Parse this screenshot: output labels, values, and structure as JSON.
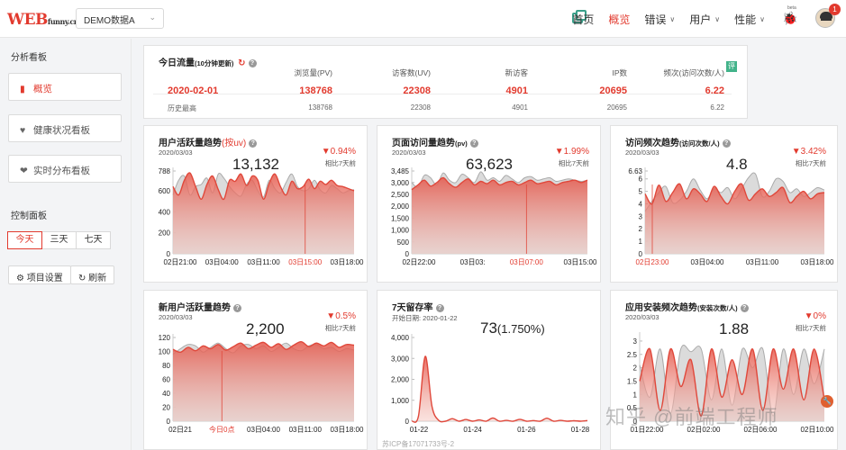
{
  "header": {
    "logo_main": "WEB",
    "logo_sub": "funny.cn",
    "project": "DEMO数据A",
    "nav": [
      {
        "label": "首页",
        "active": false,
        "caret": false
      },
      {
        "label": "概览",
        "active": true,
        "caret": false
      },
      {
        "label": "错误",
        "active": false,
        "caret": true
      },
      {
        "label": "用户",
        "active": false,
        "caret": true
      },
      {
        "label": "性能",
        "active": false,
        "caret": true
      }
    ],
    "beta": "beta",
    "notifications": "1"
  },
  "sidebar": {
    "analysis_title": "分析看板",
    "boards": [
      "概览",
      "健康状况看板",
      "实时分布看板"
    ],
    "control_title": "控制面板",
    "ranges": [
      "今天",
      "三天",
      "七天"
    ],
    "project_settings": "项目设置",
    "refresh": "刷新"
  },
  "traffic": {
    "title": "今日流量",
    "title_note": "(10分钟更新)",
    "badge": "评",
    "columns": [
      {
        "head": "",
        "value": "2020-02-01",
        "sub": "历史最高"
      },
      {
        "head": "浏览量(PV)",
        "value": "138768",
        "sub": "138768"
      },
      {
        "head": "访客数(UV)",
        "value": "22308",
        "sub": "22308"
      },
      {
        "head": "新访客",
        "value": "4901",
        "sub": "4901"
      },
      {
        "head": "IP数",
        "value": "20695",
        "sub": "20695"
      },
      {
        "head": "频次(访问次数/人)",
        "value": "6.22",
        "sub": "6.22"
      }
    ]
  },
  "cards": [
    {
      "title": "用户活跃量趋势",
      "title_hl": "(按uv)",
      "title_small": "",
      "date": "2020/03/03",
      "big": "13,132",
      "change": "▼0.94%",
      "change_sub": "相比7天前",
      "chart_data": {
        "type": "area",
        "yticks": [
          "0",
          "200",
          "400",
          "600",
          "788"
        ],
        "ylim": [
          0,
          788
        ],
        "xticks": [
          "02日21:00",
          "03日04:00",
          "03日11:00",
          "03日15:00",
          "03日18:00"
        ],
        "highlight_tick": "03日15:00",
        "values": [
          640,
          560,
          700,
          770,
          640,
          520,
          660,
          740,
          610,
          520,
          700,
          690,
          760,
          650,
          740,
          700,
          520,
          670,
          760,
          640,
          560,
          690,
          620,
          640,
          710,
          620,
          690,
          660,
          700,
          650,
          640,
          620,
          600
        ],
        "compare": [
          560,
          700,
          740,
          560,
          640,
          660,
          720,
          580,
          760,
          720,
          640,
          580,
          550,
          660,
          700,
          600,
          540,
          700,
          620,
          580,
          680,
          760,
          640,
          600,
          620,
          700,
          610,
          580,
          650,
          620,
          580,
          600,
          610
        ]
      }
    },
    {
      "title": "页面访问量趋势",
      "title_hl": "",
      "title_small": "(pv)",
      "date": "2020/03/03",
      "big": "63,623",
      "change": "▼1.99%",
      "change_sub": "相比7天前",
      "chart_data": {
        "type": "area",
        "yticks": [
          "0",
          "500",
          "1,000",
          "1,500",
          "2,000",
          "2,500",
          "3,000",
          "3,485"
        ],
        "ylim": [
          0,
          3485
        ],
        "xticks": [
          "02日22:00",
          "03日03:",
          "03日07:00",
          "03日15:00"
        ],
        "highlight_tick": "03日07:00",
        "values": [
          2700,
          2900,
          3100,
          2850,
          3000,
          3200,
          2950,
          2800,
          3000,
          3150,
          2900,
          3050,
          2950,
          3100,
          2900,
          3000,
          3050,
          2900,
          3000,
          3100,
          2950,
          3000,
          3050,
          2900,
          3000,
          3050,
          3100,
          3000,
          3100
        ],
        "compare": [
          3000,
          2800,
          3300,
          3200,
          2900,
          3400,
          3100,
          3000,
          3350,
          3200,
          3000,
          3450,
          3100,
          3200,
          3050,
          3300,
          3150,
          3000,
          3200,
          3250,
          3100,
          3150,
          3200,
          3050,
          3100,
          3150,
          3100,
          3050,
          3100
        ]
      }
    },
    {
      "title": "访问频次趋势",
      "title_hl": "",
      "title_small": "(访问次数/人)",
      "date": "2020/03/03",
      "big": "4.8",
      "change": "▼3.42%",
      "change_sub": "相比7天前",
      "chart_data": {
        "type": "area",
        "yticks": [
          "0",
          "1",
          "2",
          "3",
          "4",
          "5",
          "6",
          "6.63"
        ],
        "ylim": [
          0,
          6.63
        ],
        "xticks": [
          "02日23:00",
          "03日04:00",
          "03日11:00",
          "03日18:00"
        ],
        "highlight_tick": "02日23:00",
        "values": [
          4.8,
          4.0,
          5.5,
          4.2,
          4.9,
          5.6,
          4.4,
          5.2,
          4.8,
          4.2,
          5.4,
          4.6,
          4.0,
          5.0,
          5.6,
          4.3,
          4.8,
          5.2,
          4.6,
          4.9,
          5.3,
          4.1,
          4.6,
          5.0,
          4.4,
          4.8,
          4.9
        ],
        "compare": [
          3.4,
          4.2,
          4.9,
          5.4,
          4.1,
          4.3,
          5.0,
          6.0,
          5.1,
          4.4,
          5.2,
          4.9,
          5.3,
          4.4,
          5.2,
          6.1,
          6.4,
          4.6,
          5.0,
          6.0,
          5.8,
          4.9,
          5.2,
          4.6,
          4.9,
          5.3,
          5.1
        ]
      }
    },
    {
      "title": "新用户活跃量趋势",
      "title_hl": "",
      "title_small": "",
      "date": "2020/03/03",
      "big": "2,200",
      "change": "▼0.5%",
      "change_sub": "相比7天前",
      "chart_data": {
        "type": "area",
        "yticks": [
          "0",
          "20",
          "40",
          "60",
          "80",
          "100",
          "120"
        ],
        "ylim": [
          0,
          120
        ],
        "xticks": [
          "02日21",
          "今日0点",
          "03日04:00",
          "03日11:00",
          "03日18:00"
        ],
        "highlight_tick": "今日0点",
        "values": [
          103,
          99,
          106,
          101,
          108,
          104,
          110,
          102,
          107,
          112,
          104,
          109,
          113,
          106,
          111,
          103,
          109,
          114,
          107,
          112,
          108,
          113,
          106,
          110,
          109
        ],
        "compare": [
          96,
          104,
          110,
          108,
          99,
          106,
          112,
          104,
          98,
          108,
          110,
          104,
          108,
          100,
          106,
          112,
          104,
          101,
          108,
          110,
          104,
          106,
          100,
          104,
          102
        ]
      }
    },
    {
      "title": "7天留存率",
      "title_hl": "",
      "title_small": "",
      "date": "开始日期: 2020-01-22",
      "big": "73",
      "big_note": "(1.750%)",
      "change": "",
      "change_sub": "",
      "chart_data": {
        "type": "area",
        "yticks": [
          "0",
          "1,000",
          "2,000",
          "3,000",
          "4,000"
        ],
        "ylim": [
          0,
          4000
        ],
        "xticks": [
          "01-22",
          "01-24",
          "01-26",
          "01-28"
        ],
        "highlight_tick": "",
        "values": [
          0,
          250,
          3100,
          700,
          40,
          0,
          120,
          0,
          80,
          0,
          60,
          0,
          150,
          0,
          40,
          0,
          90,
          0,
          30,
          0,
          140,
          0,
          40,
          0,
          20,
          0,
          30
        ],
        "compare": []
      }
    },
    {
      "title": "应用安装频次趋势",
      "title_hl": "",
      "title_small": "(安装次数/人)",
      "date": "2020/03/03",
      "big": "1.88",
      "change": "▼0%",
      "change_sub": "相比7天前",
      "chart_data": {
        "type": "area",
        "yticks": [
          "0",
          "0.5",
          "1",
          "1.5",
          "2",
          "2.5",
          "3"
        ],
        "ylim": [
          0,
          3.2
        ],
        "xticks": [
          "01日22:00",
          "02日02:00",
          "02日06:00",
          "02日10:00"
        ],
        "highlight_tick": "",
        "values": [
          1.5,
          2.7,
          0.4,
          2.7,
          1.3,
          2.3,
          0.2,
          2.7,
          0.9,
          2.3,
          1.0,
          2.7,
          0.4,
          2.7,
          1.2,
          2.7,
          0.8,
          2.7,
          0.8
        ],
        "compare": [
          2.1,
          0.9,
          2.7,
          0.3,
          2.7,
          2.6,
          2.7,
          0.8,
          2.7,
          0.6,
          2.7,
          2.0,
          2.7,
          0.2,
          2.7,
          1.0,
          2.7,
          1.4,
          2.7
        ]
      }
    }
  ],
  "footer": {
    "icp": "苏ICP备17071733号-2",
    "watermark": "知乎 @前端工程师"
  }
}
